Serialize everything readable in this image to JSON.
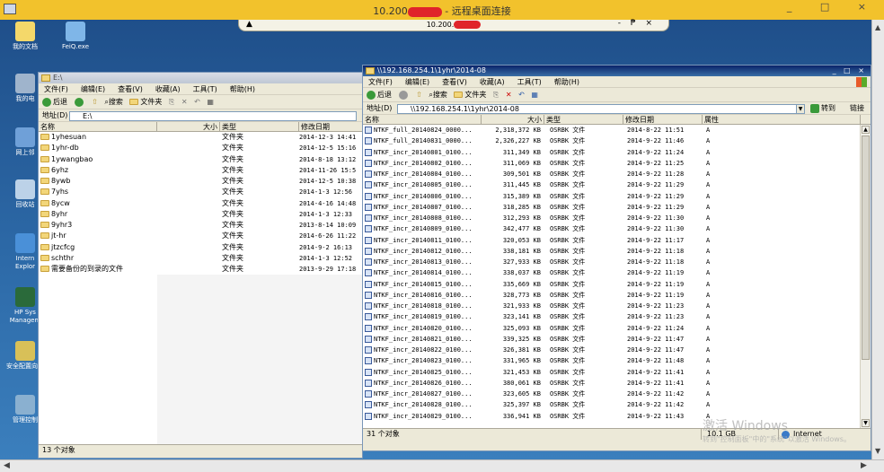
{
  "rdp": {
    "title": "10.200",
    "title_suffix": " - 远程桌面连接",
    "controls": "_ □ ×"
  },
  "conn_bar": {
    "host": "10.200.",
    "pin": "▲",
    "controls": "- ₱ ×"
  },
  "desktop_icons": [
    {
      "label": "我的文档",
      "color": "#f4d86a"
    },
    {
      "label": "FeiQ.exe",
      "color": "#7fb6e8"
    },
    {
      "label": "我的电",
      "color": "#9fb4cc"
    },
    {
      "label": "网上邻",
      "color": "#6fa0d8"
    },
    {
      "label": "回收站",
      "color": "#bcd2e8"
    },
    {
      "label": "Intern Explor",
      "color": "#4a90d8"
    },
    {
      "label": "HP Sys Managem",
      "color": "#2a6a3a"
    },
    {
      "label": "安全配置向导",
      "color": "#d8c058"
    },
    {
      "label": "管理控制",
      "color": "#8ab0d0"
    }
  ],
  "left_window": {
    "title": "E:\\",
    "menu": [
      "文件(F)",
      "编辑(E)",
      "查看(V)",
      "收藏(A)",
      "工具(T)",
      "帮助(H)"
    ],
    "toolbar": {
      "back": "后退",
      "search": "搜索",
      "folders": "文件夹"
    },
    "address_label": "地址(D)",
    "address": "E:\\",
    "columns": [
      "名称",
      "大小",
      "类型",
      "修改日期"
    ],
    "rows": [
      {
        "name": "1yhesuan",
        "type": "文件夹",
        "date": "2014-12-3 14:41"
      },
      {
        "name": "1yhr-db",
        "type": "文件夹",
        "date": "2014-12-5 15:16"
      },
      {
        "name": "1ywangbao",
        "type": "文件夹",
        "date": "2014-8-18 13:12"
      },
      {
        "name": "6yhz",
        "type": "文件夹",
        "date": "2014-11-26 15:5"
      },
      {
        "name": "8ywb",
        "type": "文件夹",
        "date": "2014-12-5 10:38"
      },
      {
        "name": "7yhs",
        "type": "文件夹",
        "date": "2014-1-3 12:56"
      },
      {
        "name": "8ycw",
        "type": "文件夹",
        "date": "2014-4-16 14:48"
      },
      {
        "name": "8yhr",
        "type": "文件夹",
        "date": "2014-1-3 12:33"
      },
      {
        "name": "9yhr3",
        "type": "文件夹",
        "date": "2013-8-14 10:09"
      },
      {
        "name": "jt-hr",
        "type": "文件夹",
        "date": "2014-6-26 11:22"
      },
      {
        "name": "jtzcfcg",
        "type": "文件夹",
        "date": "2014-9-2 16:13"
      },
      {
        "name": "schthr",
        "type": "文件夹",
        "date": "2014-1-3 12:52"
      },
      {
        "name": "需要备份的到录的文件",
        "type": "文件夹",
        "date": "2013-9-29 17:18"
      }
    ],
    "status": "13 个对象"
  },
  "right_window": {
    "title": "\\\\192.168.254.1\\1yhr\\2014-08",
    "controls": "_ □ ×",
    "menu": [
      "文件(F)",
      "编辑(E)",
      "查看(V)",
      "收藏(A)",
      "工具(T)",
      "帮助(H)"
    ],
    "toolbar": {
      "back": "后退",
      "search": "搜索",
      "folders": "文件夹"
    },
    "address_label": "地址(D)",
    "address": "\\\\192.168.254.1\\1yhr\\2014-08",
    "go": "转到",
    "links": "链接",
    "columns": [
      "名称",
      "大小",
      "类型",
      "修改日期",
      "属性"
    ],
    "rows": [
      {
        "name": "NTKF_full_20140824_0000...",
        "size": "2,318,372 KB",
        "type": "OSRBK 文件",
        "date": "2014-8-22 11:51",
        "attr": "A"
      },
      {
        "name": "NTKF_full_20140831_0000...",
        "size": "2,326,227 KB",
        "type": "OSRBK 文件",
        "date": "2014-9-22 11:46",
        "attr": "A"
      },
      {
        "name": "NTKF_incr_20140801_0100...",
        "size": "311,349 KB",
        "type": "OSRBK 文件",
        "date": "2014-9-22 11:24",
        "attr": "A"
      },
      {
        "name": "NTKF_incr_20140802_0100...",
        "size": "311,069 KB",
        "type": "OSRBK 文件",
        "date": "2014-9-22 11:25",
        "attr": "A"
      },
      {
        "name": "NTKF_incr_20140804_0100...",
        "size": "309,501 KB",
        "type": "OSRBK 文件",
        "date": "2014-9-22 11:28",
        "attr": "A"
      },
      {
        "name": "NTKF_incr_20140805_0100...",
        "size": "311,445 KB",
        "type": "OSRBK 文件",
        "date": "2014-9-22 11:29",
        "attr": "A"
      },
      {
        "name": "NTKF_incr_20140806_0100...",
        "size": "315,389 KB",
        "type": "OSRBK 文件",
        "date": "2014-9-22 11:29",
        "attr": "A"
      },
      {
        "name": "NTKF_incr_20140807_0100...",
        "size": "318,285 KB",
        "type": "OSRBK 文件",
        "date": "2014-9-22 11:29",
        "attr": "A"
      },
      {
        "name": "NTKF_incr_20140808_0100...",
        "size": "312,293 KB",
        "type": "OSRBK 文件",
        "date": "2014-9-22 11:30",
        "attr": "A"
      },
      {
        "name": "NTKF_incr_20140809_0100...",
        "size": "342,477 KB",
        "type": "OSRBK 文件",
        "date": "2014-9-22 11:30",
        "attr": "A"
      },
      {
        "name": "NTKF_incr_20140811_0100...",
        "size": "320,053 KB",
        "type": "OSRBK 文件",
        "date": "2014-9-22 11:17",
        "attr": "A"
      },
      {
        "name": "NTKF_incr_20140812_0100...",
        "size": "338,181 KB",
        "type": "OSRBK 文件",
        "date": "2014-9-22 11:18",
        "attr": "A"
      },
      {
        "name": "NTKF_incr_20140813_0100...",
        "size": "327,933 KB",
        "type": "OSRBK 文件",
        "date": "2014-9-22 11:18",
        "attr": "A"
      },
      {
        "name": "NTKF_incr_20140814_0100...",
        "size": "338,037 KB",
        "type": "OSRBK 文件",
        "date": "2014-9-22 11:19",
        "attr": "A"
      },
      {
        "name": "NTKF_incr_20140815_0100...",
        "size": "335,669 KB",
        "type": "OSRBK 文件",
        "date": "2014-9-22 11:19",
        "attr": "A"
      },
      {
        "name": "NTKF_incr_20140816_0100...",
        "size": "328,773 KB",
        "type": "OSRBK 文件",
        "date": "2014-9-22 11:19",
        "attr": "A"
      },
      {
        "name": "NTKF_incr_20140818_0100...",
        "size": "321,933 KB",
        "type": "OSRBK 文件",
        "date": "2014-9-22 11:23",
        "attr": "A"
      },
      {
        "name": "NTKF_incr_20140819_0100...",
        "size": "323,141 KB",
        "type": "OSRBK 文件",
        "date": "2014-9-22 11:23",
        "attr": "A"
      },
      {
        "name": "NTKF_incr_20140820_0100...",
        "size": "325,093 KB",
        "type": "OSRBK 文件",
        "date": "2014-9-22 11:24",
        "attr": "A"
      },
      {
        "name": "NTKF_incr_20140821_0100...",
        "size": "339,325 KB",
        "type": "OSRBK 文件",
        "date": "2014-9-22 11:47",
        "attr": "A"
      },
      {
        "name": "NTKF_incr_20140822_0100...",
        "size": "326,381 KB",
        "type": "OSRBK 文件",
        "date": "2014-9-22 11:47",
        "attr": "A"
      },
      {
        "name": "NTKF_incr_20140823_0100...",
        "size": "331,965 KB",
        "type": "OSRBK 文件",
        "date": "2014-9-22 11:48",
        "attr": "A"
      },
      {
        "name": "NTKF_incr_20140825_0100...",
        "size": "321,453 KB",
        "type": "OSRBK 文件",
        "date": "2014-9-22 11:41",
        "attr": "A"
      },
      {
        "name": "NTKF_incr_20140826_0100...",
        "size": "380,061 KB",
        "type": "OSRBK 文件",
        "date": "2014-9-22 11:41",
        "attr": "A"
      },
      {
        "name": "NTKF_incr_20140827_0100...",
        "size": "323,605 KB",
        "type": "OSRBK 文件",
        "date": "2014-9-22 11:42",
        "attr": "A"
      },
      {
        "name": "NTKF_incr_20140828_0100...",
        "size": "325,397 KB",
        "type": "OSRBK 文件",
        "date": "2014-9-22 11:42",
        "attr": "A"
      },
      {
        "name": "NTKF_incr_20140829_0100...",
        "size": "336,941 KB",
        "type": "OSRBK 文件",
        "date": "2014-9-22 11:43",
        "attr": "A"
      }
    ],
    "status": "31 个对象",
    "status_size": "10.1 GB",
    "zone": "Internet"
  },
  "watermark": {
    "line1": "激活 Windows",
    "line2": "转到\"控制面板\"中的\"系统\"以激活 Windows。"
  }
}
